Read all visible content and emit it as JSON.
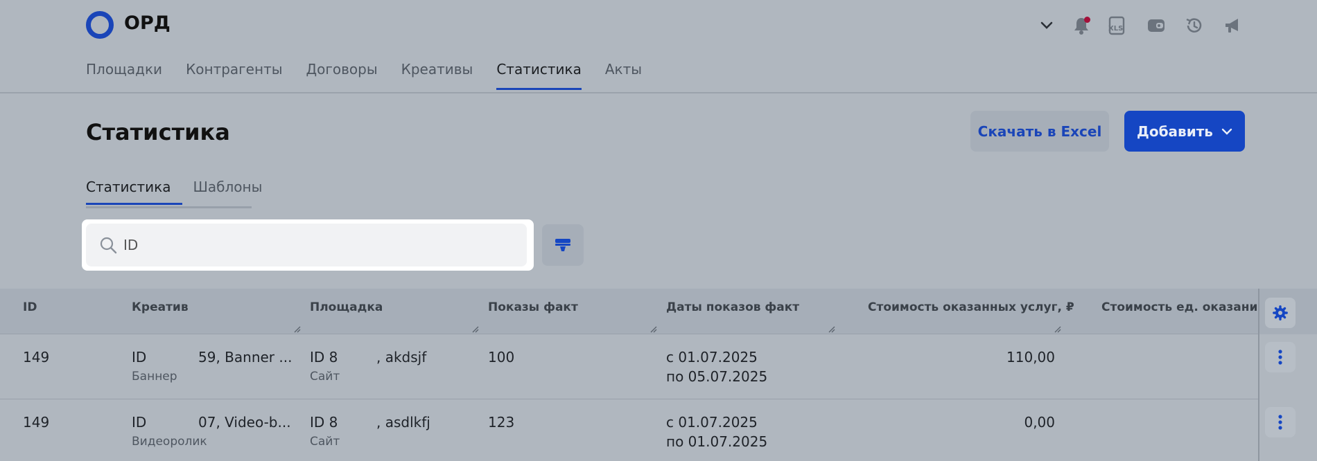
{
  "app": {
    "logo_text": "ОРД"
  },
  "nav": {
    "items": [
      {
        "label": "Площадки"
      },
      {
        "label": "Контрагенты"
      },
      {
        "label": "Договоры"
      },
      {
        "label": "Креативы"
      },
      {
        "label": "Статистика",
        "active": true
      },
      {
        "label": "Акты"
      }
    ]
  },
  "page": {
    "title": "Статистика",
    "excel_button": "Скачать в Excel",
    "add_button": "Добавить"
  },
  "subtabs": [
    {
      "label": "Статистика",
      "active": true
    },
    {
      "label": "Шаблоны"
    }
  ],
  "search": {
    "placeholder": "ID",
    "value": ""
  },
  "table": {
    "columns": [
      "ID",
      "Креатив",
      "Площадка",
      "Показы факт",
      "Даты показов факт",
      "Стоимость оказанных услуг, ₽",
      "Стоимость ед. оказания у"
    ],
    "rows": [
      {
        "id": "149",
        "creative_id": "ID",
        "creative_name": "59, Banner ...",
        "creative_type": "Баннер",
        "platform_id": "ID 8",
        "platform_name": ", akdsjf",
        "platform_type": "Сайт",
        "impressions": "100",
        "date_from": "с 01.07.2025",
        "date_to": "по 05.07.2025",
        "cost": "110,00"
      },
      {
        "id": "149",
        "creative_id": "ID",
        "creative_name": "07, Video-b...",
        "creative_type": "Видеоролик",
        "platform_id": "ID 8",
        "platform_name": ", asdlkfj",
        "platform_type": "Сайт",
        "impressions": "123",
        "date_from": "с 01.07.2025",
        "date_to": "по 01.07.2025",
        "cost": "0,00"
      }
    ]
  },
  "colors": {
    "accent": "#1546c3",
    "background": "#b0b7bf",
    "notification_dot": "#a4103a"
  },
  "icons": [
    "chevron-down-icon",
    "bell-icon",
    "xls-icon",
    "wallet-icon",
    "history-icon",
    "megaphone-icon",
    "search-icon",
    "filter-icon",
    "gear-icon",
    "kebab-icon"
  ]
}
